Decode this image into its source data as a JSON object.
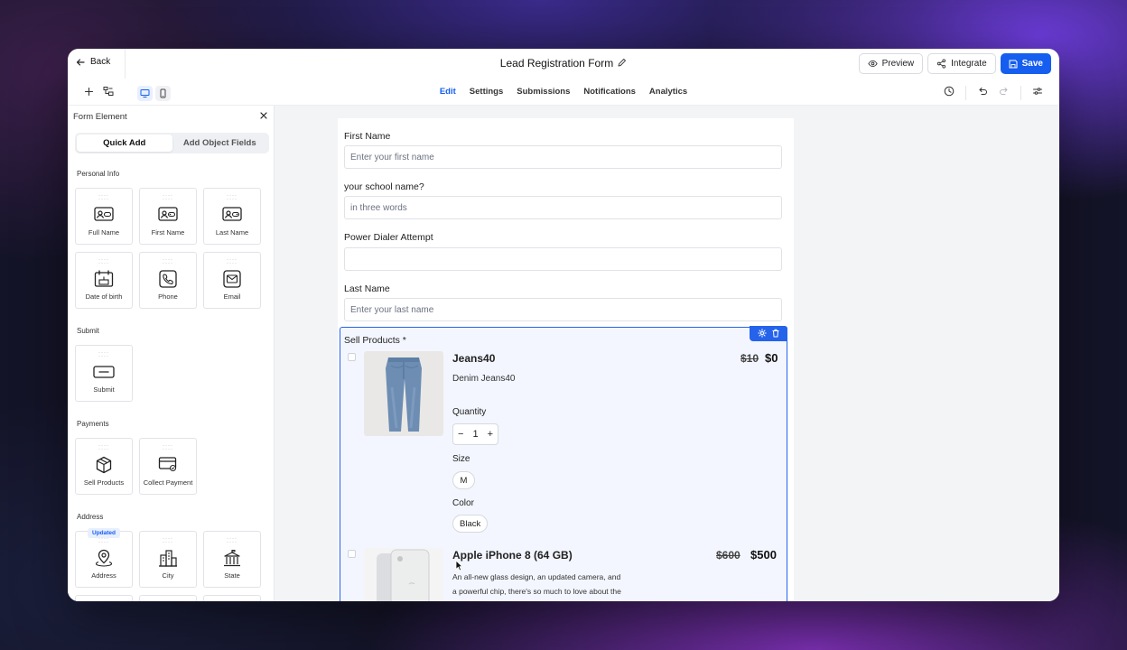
{
  "header": {
    "back_label": "Back",
    "form_title": "Lead Registration Form",
    "preview_label": "Preview",
    "integrate_label": "Integrate",
    "save_label": "Save"
  },
  "toolbar": {
    "tabs": [
      "Edit",
      "Settings",
      "Submissions",
      "Notifications",
      "Analytics"
    ],
    "active_tab": "Edit"
  },
  "sidebar": {
    "title": "Form Element",
    "segments": [
      "Quick Add",
      "Add Object Fields"
    ],
    "active_segment": "Quick Add",
    "sections": [
      {
        "label": "Personal Info",
        "items": [
          "Full Name",
          "First Name",
          "Last Name",
          "Date of birth",
          "Phone",
          "Email"
        ]
      },
      {
        "label": "Submit",
        "items": [
          "Submit"
        ]
      },
      {
        "label": "Payments",
        "items": [
          "Sell Products",
          "Collect Payment"
        ]
      },
      {
        "label": "Address",
        "items": [
          "Address",
          "City",
          "State"
        ]
      }
    ],
    "address_badge": "Updated"
  },
  "form": {
    "fields": [
      {
        "label": "First Name",
        "placeholder": "Enter your first name"
      },
      {
        "label": "your school name?",
        "placeholder": "in three words"
      },
      {
        "label": "Power Dialer Attempt",
        "placeholder": ""
      },
      {
        "label": "Last Name",
        "placeholder": "Enter your last name"
      }
    ],
    "products_label": "Sell Products *",
    "products": [
      {
        "name": "Jeans40",
        "description": "Denim Jeans40",
        "old_price": "$10",
        "price": "$0",
        "quantity_label": "Quantity",
        "quantity": "1",
        "size_label": "Size",
        "size": "M",
        "color_label": "Color",
        "color": "Black"
      },
      {
        "name": "Apple iPhone 8 (64 GB)",
        "description_line1": "An all-new glass design, an updated camera, and",
        "description_line2": "a powerful chip, there's so much to love about the",
        "old_price": "$600",
        "price": "$500"
      }
    ]
  },
  "colors": {
    "accent": "#155eef",
    "selection_border": "#2563eb",
    "canvas_bg": "#f3f4f6"
  }
}
